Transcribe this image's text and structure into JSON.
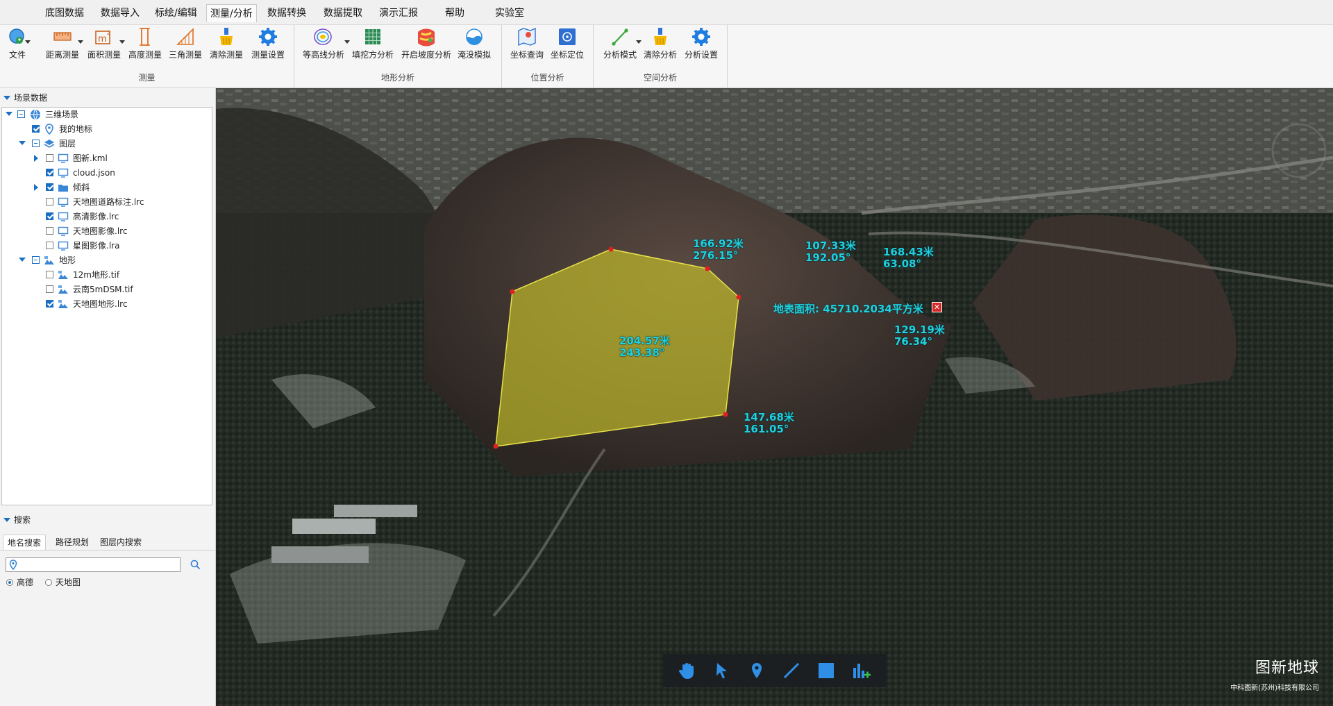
{
  "menubar": {
    "items": [
      "底图数据",
      "数据导入",
      "标绘/编辑",
      "测量/分析",
      "数据转换",
      "数据提取",
      "演示汇报",
      "帮助",
      "实验室"
    ],
    "active": "测量/分析"
  },
  "ribbon": {
    "file_label": "文件",
    "groups": [
      {
        "label": "测量",
        "buttons": [
          "距离测量",
          "面积测量",
          "高度测量",
          "三角测量",
          "清除测量",
          "测量设置"
        ]
      },
      {
        "label": "地形分析",
        "buttons": [
          "等高线分析",
          "填挖方分析",
          "开启坡度分析",
          "淹没模拟"
        ]
      },
      {
        "label": "位置分析",
        "buttons": [
          "坐标查询",
          "坐标定位"
        ]
      },
      {
        "label": "空间分析",
        "buttons": [
          "分析模式",
          "清除分析",
          "分析设置"
        ]
      }
    ]
  },
  "scene_panel": {
    "title": "场景数据",
    "tree": [
      {
        "label": "三维场景",
        "level": 0
      },
      {
        "label": "我的地标",
        "level": 1
      },
      {
        "label": "图层",
        "level": 1
      },
      {
        "label": "图新.kml",
        "level": 2
      },
      {
        "label": "cloud.json",
        "level": 2
      },
      {
        "label": "倾斜",
        "level": 2
      },
      {
        "label": "天地图道路标注.lrc",
        "level": 2
      },
      {
        "label": "高清影像.lrc",
        "level": 2
      },
      {
        "label": "天地图影像.lrc",
        "level": 2
      },
      {
        "label": "星图影像.lra",
        "level": 2
      },
      {
        "label": "地形",
        "level": 1
      },
      {
        "label": "12m地形.tif",
        "level": 2
      },
      {
        "label": "云南5mDSM.tif",
        "level": 2
      },
      {
        "label": "天地图地形.lrc",
        "level": 2
      }
    ]
  },
  "search_panel": {
    "title": "搜索",
    "tabs": [
      "地名搜索",
      "路径规划",
      "图层内搜索"
    ],
    "active_tab": "地名搜索",
    "input_value": "",
    "sources": [
      "高德",
      "天地图"
    ],
    "selected_source": "高德"
  },
  "map": {
    "measurements": [
      {
        "distance": "166.92米",
        "angle": "276.15°"
      },
      {
        "distance": "107.33米",
        "angle": "192.05°"
      },
      {
        "distance": "168.43米",
        "angle": "63.08°"
      },
      {
        "distance": "129.19米",
        "angle": "76.34°"
      },
      {
        "distance": "204.57米",
        "angle": "243.38°"
      },
      {
        "distance": "147.68米",
        "angle": "161.05°"
      }
    ],
    "area_label": "地表面积: 45710.2034平方米",
    "area_close": "✕",
    "polygon_color": "#c9c32a",
    "label_color": "#1fd0dd",
    "toolbar_tools": [
      "pan-hand-icon",
      "select-arrow-icon",
      "place-marker-icon",
      "draw-line-icon",
      "draw-polygon-icon",
      "bar-chart-add-icon"
    ]
  },
  "branding": {
    "title": "图新地球",
    "subtitle": "中科图新(苏州)科技有限公司"
  }
}
